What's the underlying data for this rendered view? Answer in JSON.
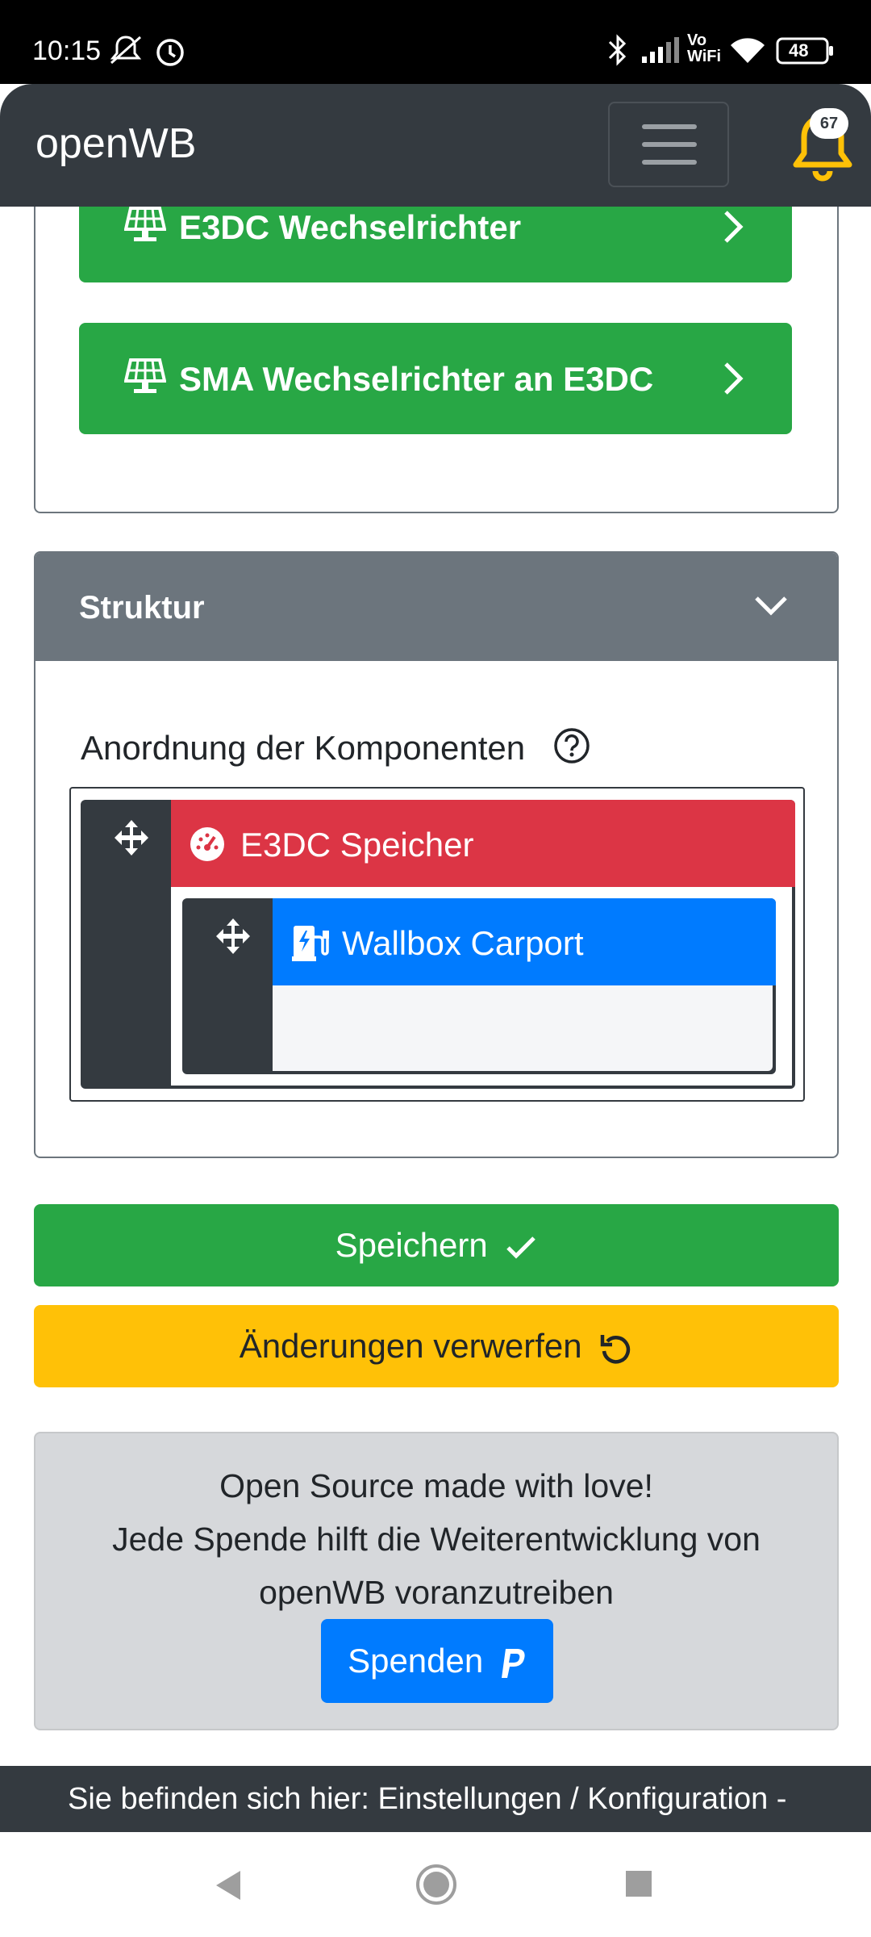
{
  "status_bar": {
    "time": "10:15",
    "battery": "48",
    "network_label_top": "Vo",
    "network_label_bottom": "WiFi"
  },
  "navbar": {
    "brand": "openWB",
    "notification_count": "67"
  },
  "components": {
    "items": [
      {
        "label": "E3DC Wechselrichter",
        "icon": "solar-panel-icon"
      },
      {
        "label": "SMA Wechselrichter an E3DC",
        "icon": "solar-panel-icon"
      }
    ]
  },
  "structure": {
    "title": "Struktur",
    "arrangement_label": "Anordnung der Komponenten",
    "tree": {
      "root": {
        "label": "E3DC Speicher",
        "color": "#dc3545",
        "icon": "battery-gauge-icon"
      },
      "child": {
        "label": "Wallbox Carport",
        "color": "#007bff",
        "icon": "charging-station-icon"
      }
    }
  },
  "actions": {
    "save_label": "Speichern",
    "discard_label": "Änderungen verwerfen"
  },
  "donate": {
    "line1": "Open Source made with love!",
    "line2": "Jede Spende hilft die Weiterentwicklung von",
    "line3": "openWB voranzutreiben",
    "button_label": "Spenden"
  },
  "breadcrumb": {
    "text": "Sie befinden sich hier: Einstellungen / Konfiguration -"
  },
  "colors": {
    "success": "#28a745",
    "warning": "#ffc107",
    "primary": "#007bff",
    "danger": "#dc3545",
    "dark": "#343a40",
    "secondary": "#6c757d",
    "notification_bell": "#ffc107"
  }
}
